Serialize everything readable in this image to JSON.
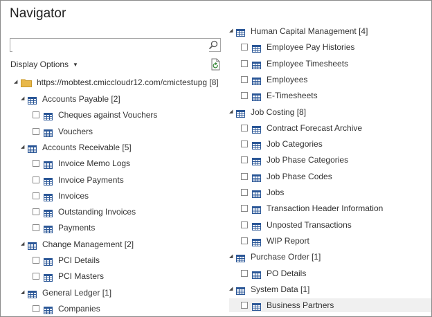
{
  "navigator": {
    "title": "Navigator",
    "search_value": "",
    "display_options_label": "Display Options"
  },
  "tree": {
    "root": {
      "label": "https://mobtest.cmiccloudr12.com/cmictestupg [8]"
    },
    "left": [
      {
        "label": "Accounts Payable [2]",
        "items": [
          "Cheques against Vouchers",
          "Vouchers"
        ]
      },
      {
        "label": "Accounts Receivable [5]",
        "items": [
          "Invoice Memo Logs",
          "Invoice Payments",
          "Invoices",
          "Outstanding Invoices",
          "Payments"
        ]
      },
      {
        "label": "Change Management [2]",
        "items": [
          "PCI Details",
          "PCI Masters"
        ]
      },
      {
        "label": "General Ledger [1]",
        "items": [
          "Companies"
        ]
      }
    ],
    "right": [
      {
        "label": "Human Capital Management [4]",
        "items": [
          "Employee Pay Histories",
          "Employee Timesheets",
          "Employees",
          "E-Timesheets"
        ]
      },
      {
        "label": "Job Costing [8]",
        "items": [
          "Contract Forecast Archive",
          "Job Categories",
          "Job Phase Categories",
          "Job Phase Codes",
          "Jobs",
          "Transaction Header Information",
          "Unposted Transactions",
          "WIP Report"
        ]
      },
      {
        "label": "Purchase Order [1]",
        "items": [
          "PO Details"
        ]
      },
      {
        "label": "System Data [1]",
        "items": [
          "Business Partners"
        ],
        "highlighted": true
      }
    ]
  }
}
